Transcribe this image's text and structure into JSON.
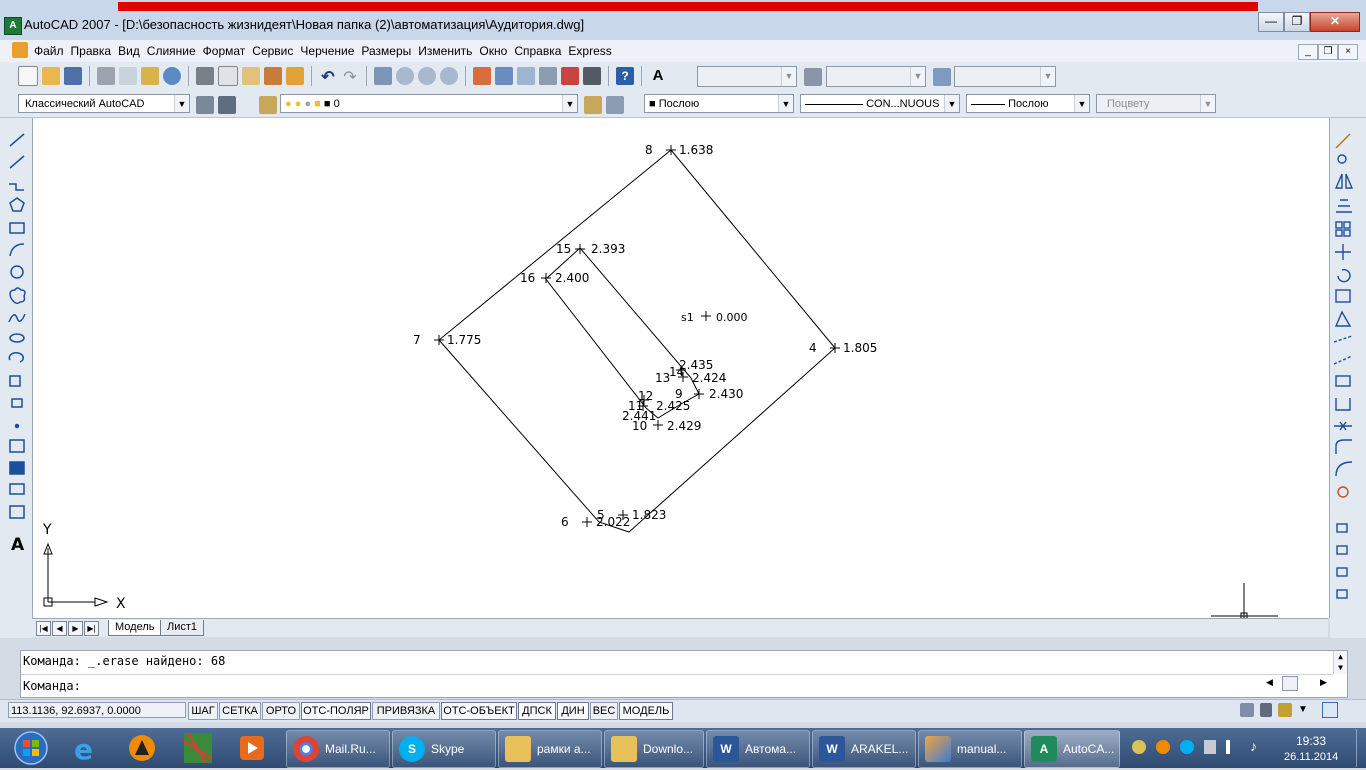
{
  "window": {
    "title": "AutoCAD 2007 - [D:\\безопасность жизнидеят\\Новая папка (2)\\автоматизация\\Аудитория.dwg]",
    "icon_text": "A"
  },
  "menu": {
    "items": [
      "Файл",
      "Правка",
      "Вид",
      "Слияние",
      "Формат",
      "Сервис",
      "Черчение",
      "Размеры",
      "Изменить",
      "Окно",
      "Справка",
      "Express"
    ]
  },
  "toolbar": {
    "workspace": "Классический AutoCAD",
    "layer": "0",
    "color": "Послою",
    "linetype": "CON...NUOUS",
    "lineweight": "Послою",
    "plotstyle": "Поцвету"
  },
  "drawing": {
    "points": [
      {
        "id": "8",
        "value": "1.638"
      },
      {
        "id": "15",
        "value": "2.393"
      },
      {
        "id": "16",
        "value": "2.400"
      },
      {
        "id": "s1",
        "value": "0.000"
      },
      {
        "id": "7",
        "value": "1.775"
      },
      {
        "id": "4",
        "value": "1.805"
      },
      {
        "id": "14",
        "value": "2.435"
      },
      {
        "id": "13",
        "value": "2.424"
      },
      {
        "id": "9",
        "value": "2.430"
      },
      {
        "id": "12",
        "value": ""
      },
      {
        "id": "11",
        "value": "2.425"
      },
      {
        "id": "",
        "value": "2.441"
      },
      {
        "id": "10",
        "value": "2.429"
      },
      {
        "id": "5",
        "value": "1.823"
      },
      {
        "id": "6",
        "value": "2.022"
      }
    ],
    "ucs_x": "X",
    "ucs_y": "Y"
  },
  "tabs": {
    "model": "Модель",
    "layout1": "Лист1"
  },
  "command": {
    "line1": "Команда: _.erase найдено: 68",
    "line2": "Команда:"
  },
  "status": {
    "coords": "113.1136, 92.6937, 0.0000",
    "buttons": [
      "ШАГ",
      "СЕТКА",
      "ОРТО",
      "ОТС-ПОЛЯР",
      "ПРИВЯЗКА",
      "ОТС-ОБЪЕКТ",
      "ДПСК",
      "ДИН",
      "ВЕС",
      "МОДЕЛЬ"
    ]
  },
  "taskbar": {
    "tasks": [
      {
        "label": "Mail.Ru...",
        "icon": "chrome-icon"
      },
      {
        "label": "Skype",
        "icon": "skype-icon"
      },
      {
        "label": "рамки а...",
        "icon": "folder-icon"
      },
      {
        "label": "Downlo...",
        "icon": "download-folder-icon"
      },
      {
        "label": "Автома...",
        "icon": "word-icon"
      },
      {
        "label": "ARAKEL...",
        "icon": "word-icon"
      },
      {
        "label": "manual...",
        "icon": "app-icon"
      },
      {
        "label": "AutoCA...",
        "icon": "autocad-icon"
      }
    ],
    "time": "19:33",
    "date": "26.11.2014"
  },
  "colors": {
    "title_red": "#e00000",
    "taskbar": "#2f4b72",
    "drawing_bg": "#ffffff"
  }
}
